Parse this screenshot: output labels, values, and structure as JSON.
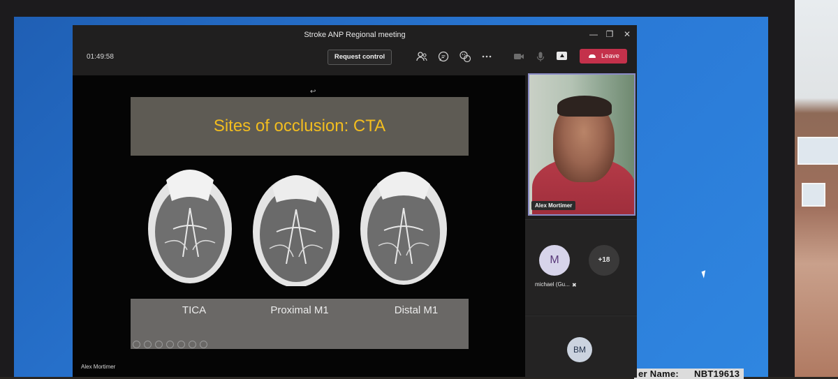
{
  "window": {
    "title": "Stroke ANP Regional meeting"
  },
  "toolbar": {
    "timer": "01:49:58",
    "request_control": "Request control",
    "leave": "Leave"
  },
  "slide": {
    "title": "Sites of occlusion: CTA",
    "labels": [
      "TICA",
      "Proximal M1",
      "Distal M1"
    ],
    "presenter": "Alex Mortimer"
  },
  "participants": {
    "video_name": "Alex Mortimer",
    "m_initial": "M",
    "m_name": "michael (Gu...",
    "overflow": "+18",
    "bm_initials": "BM"
  },
  "desktop": {
    "sticker_prefix": "er Name:",
    "sticker_code": "NBT19613"
  },
  "colors": {
    "leave": "#c4314b",
    "slide_title_text": "#f2bd1f",
    "active_speaker_border": "#8b8cc7"
  }
}
